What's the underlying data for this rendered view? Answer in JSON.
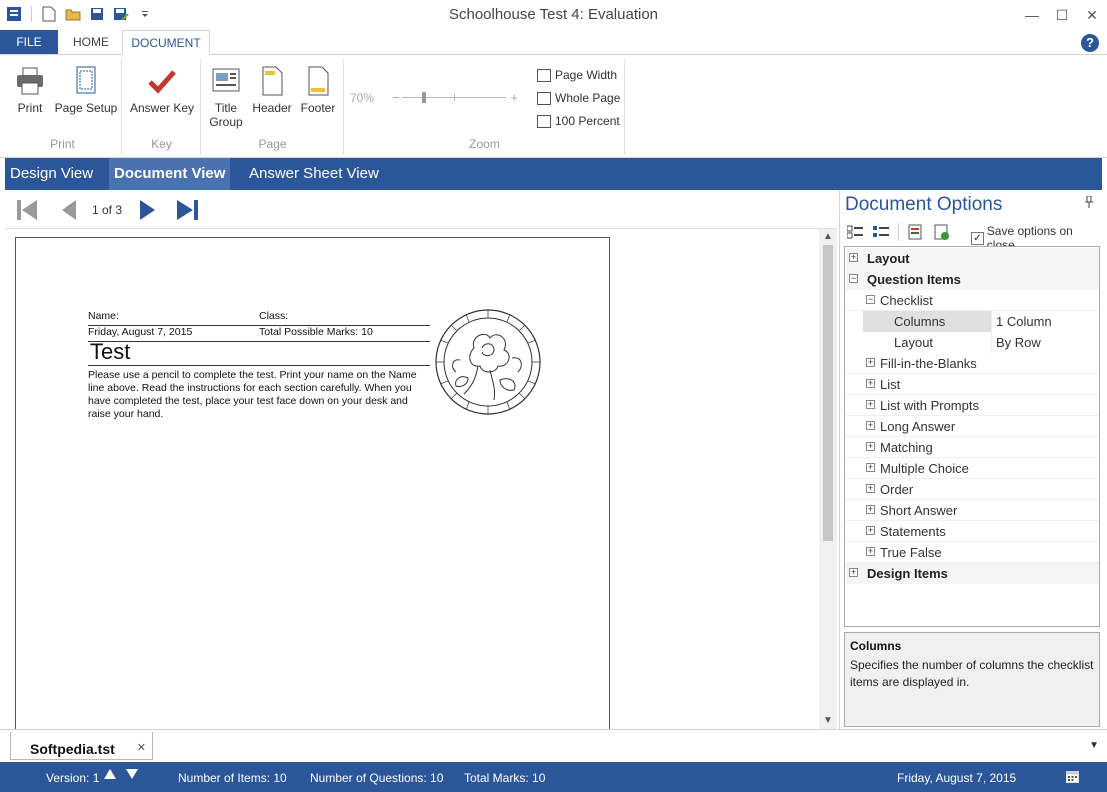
{
  "window": {
    "title": "Schoolhouse Test 4: Evaluation",
    "minimize": "—",
    "maximize": "☐",
    "close": "✕"
  },
  "ribbon_tabs": {
    "file": "FILE",
    "home": "HOME",
    "document": "DOCUMENT",
    "help": "?"
  },
  "ribbon": {
    "print_group": {
      "label": "Print",
      "print": "Print",
      "page_setup": "Page Setup"
    },
    "key_group": {
      "label": "Key",
      "answer_key": "Answer Key"
    },
    "page_group": {
      "label": "Page",
      "title_group_1": "Title",
      "title_group_2": "Group",
      "header": "Header",
      "footer": "Footer"
    },
    "zoom_group": {
      "label": "Zoom",
      "percent": "70%",
      "minus": "−",
      "plus": "+",
      "page_width": "Page Width",
      "whole_page": "Whole Page",
      "hundred_percent": "100 Percent"
    }
  },
  "views": {
    "design": "Design View",
    "document": "Document View",
    "answer_sheet": "Answer Sheet View",
    "active": "document"
  },
  "navigation": {
    "page_indicator": "1 of 3"
  },
  "document": {
    "name_label": "Name:",
    "class_label": "Class:",
    "date": "Friday, August 7, 2015",
    "total_marks": "Total Possible Marks: 10",
    "title": "Test",
    "instructions": "Please use a pencil to complete the test. Print your name on the Name line above. Read the instructions for each section carefully. When you have completed the test, place your test face down on your desk and raise your hand."
  },
  "options_panel": {
    "title": "Document Options",
    "pin": "📌",
    "save_on_close": "Save options on close",
    "save_on_close_checked": true,
    "tree": {
      "layout": "Layout",
      "question_items": "Question Items",
      "checklist": "Checklist",
      "columns_name": "Columns",
      "columns_value": "1 Column",
      "layout_name": "Layout",
      "layout_value": "By Row",
      "fill_in": "Fill-in-the-Blanks",
      "list": "List",
      "list_prompts": "List with Prompts",
      "long_answer": "Long Answer",
      "matching": "Matching",
      "multiple_choice": "Multiple Choice",
      "order": "Order",
      "short_answer": "Short Answer",
      "statements": "Statements",
      "true_false": "True False",
      "design_items": "Design Items"
    },
    "help": {
      "title": "Columns",
      "description": "Specifies the number of columns the checklist items are displayed in."
    }
  },
  "doc_tabs": {
    "active": "Softpedia.tst",
    "close": "✕",
    "dropdown": "▼"
  },
  "status": {
    "version": "Version: 1",
    "items": "Number of Items: 10",
    "questions": "Number of Questions: 10",
    "marks": "Total Marks: 10",
    "date": "Friday, August 7, 2015"
  },
  "colors": {
    "accent": "#2b579a",
    "active_view": "#4a72b0",
    "panel_title": "#2b579a"
  }
}
